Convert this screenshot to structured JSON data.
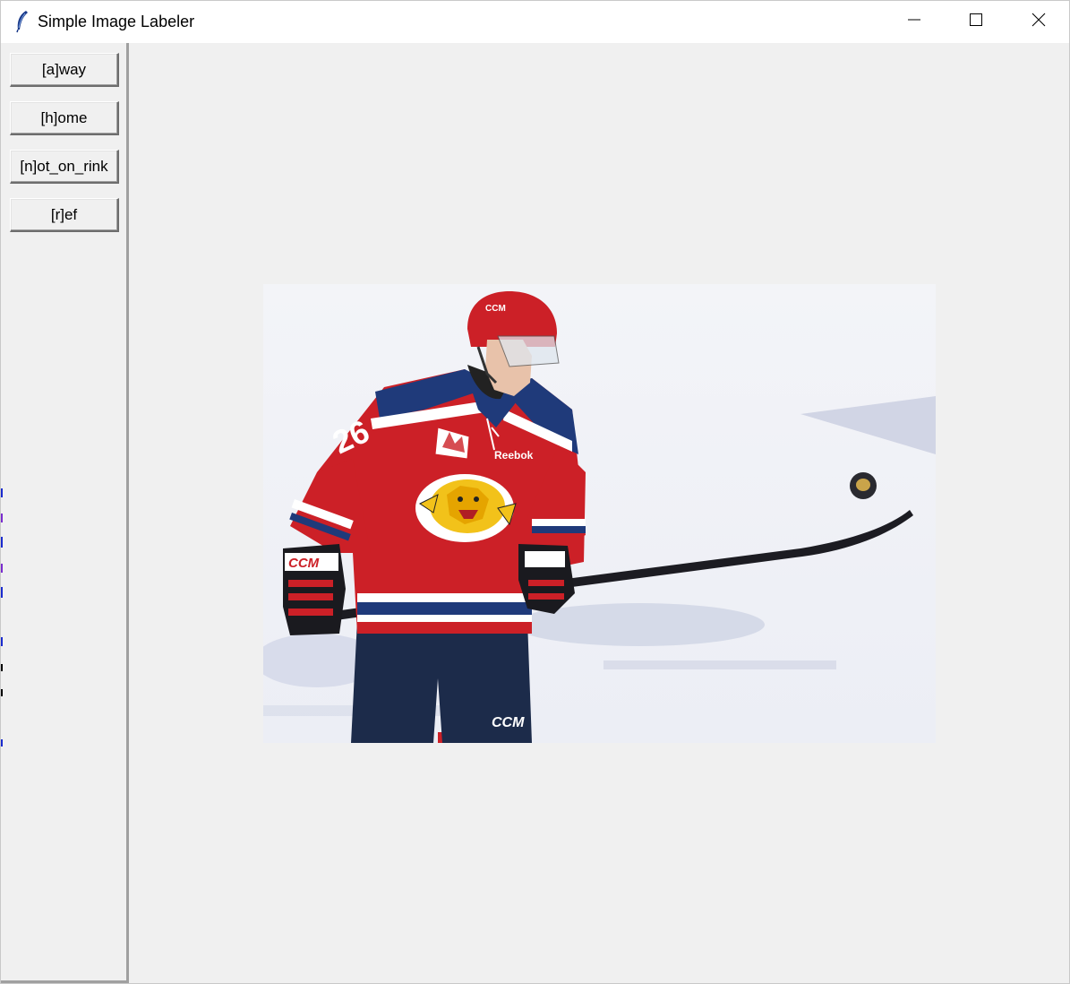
{
  "window": {
    "title": "Simple Image Labeler",
    "controls": [
      "minimize",
      "maximize",
      "close"
    ]
  },
  "sidebar": {
    "buttons": [
      {
        "label": "[a]way"
      },
      {
        "label": "[h]ome"
      },
      {
        "label": "[n]ot_on_rink"
      },
      {
        "label": "[r]ef"
      }
    ]
  },
  "image": {
    "description_icon": "hockey-player-photo",
    "jersey_number": "26",
    "helmet_text": "CCM",
    "glove_text": "CCM",
    "shorts_text": "CCM",
    "jersey_brand": "Reebok"
  },
  "colors": {
    "window_bg": "#f0f0f0",
    "titlebar_bg": "#ffffff",
    "jersey_red": "#cc2027",
    "jersey_navy": "#1f3a7a",
    "shorts_navy": "#1c2b4a"
  }
}
